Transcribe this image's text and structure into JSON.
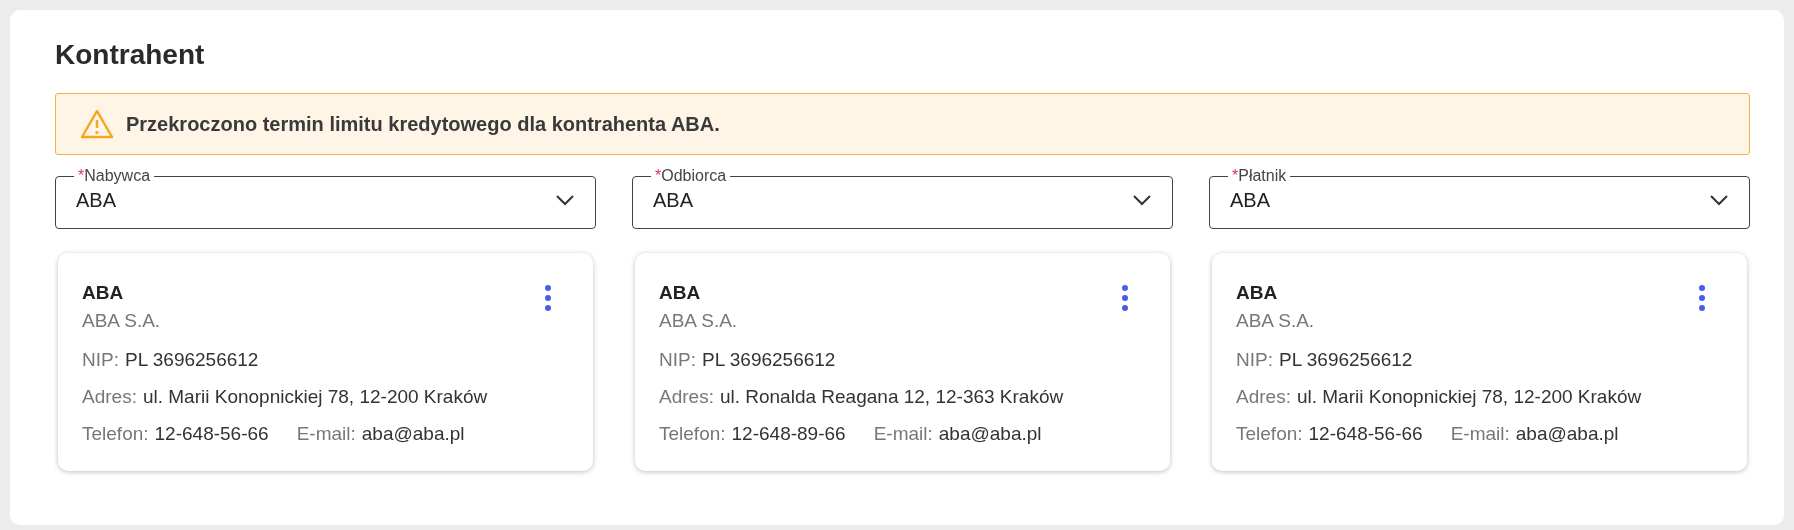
{
  "section": {
    "title": "Kontrahent"
  },
  "alert": {
    "message": "Przekroczono termin limitu kredytowego dla kontrahenta ABA."
  },
  "parties": [
    {
      "field": {
        "required_mark": "*",
        "label": "Nabywca",
        "value": "ABA"
      },
      "card": {
        "name": "ABA",
        "company": "ABA S.A.",
        "nip_label": "NIP:",
        "nip": "PL 3696256612",
        "address_label": "Adres:",
        "address": "ul. Marii Konopnickiej 78, 12-200 Kraków",
        "phone_label": "Telefon:",
        "phone": "12-648-56-66",
        "email_label": "E-mail:",
        "email": "aba@aba.pl"
      }
    },
    {
      "field": {
        "required_mark": "*",
        "label": "Odbiorca",
        "value": "ABA"
      },
      "card": {
        "name": "ABA",
        "company": "ABA S.A.",
        "nip_label": "NIP:",
        "nip": "PL 3696256612",
        "address_label": "Adres:",
        "address": "ul. Ronalda Reagana 12, 12-363 Kraków",
        "phone_label": "Telefon:",
        "phone": "12-648-89-66",
        "email_label": "E-mail:",
        "email": "aba@aba.pl"
      }
    },
    {
      "field": {
        "required_mark": "*",
        "label": "Płatnik",
        "value": "ABA"
      },
      "card": {
        "name": "ABA",
        "company": "ABA S.A.",
        "nip_label": "NIP:",
        "nip": "PL 3696256612",
        "address_label": "Adres:",
        "address": "ul. Marii Konopnickiej 78, 12-200 Kraków",
        "phone_label": "Telefon:",
        "phone": "12-648-56-66",
        "email_label": "E-mail:",
        "email": "aba@aba.pl"
      }
    }
  ]
}
